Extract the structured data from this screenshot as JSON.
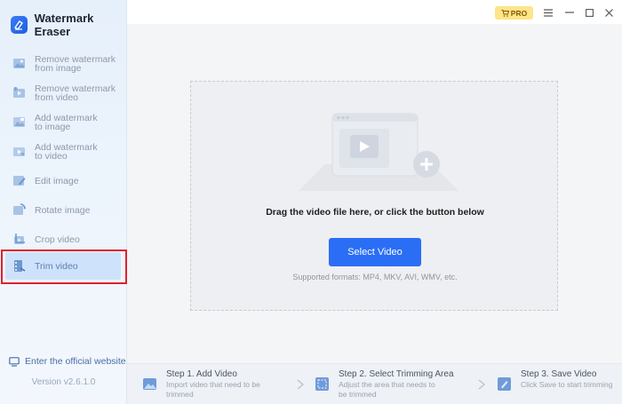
{
  "app": {
    "title": "Watermark Eraser",
    "pro_badge": "PRO"
  },
  "sidebar": {
    "items": [
      {
        "line1": "Remove watermark",
        "line2": "from image",
        "icon": "image-remove-icon",
        "active": false
      },
      {
        "line1": "Remove watermark",
        "line2": "from video",
        "icon": "video-remove-icon",
        "active": false
      },
      {
        "line1": "Add watermark",
        "line2": "to image",
        "icon": "image-add-icon",
        "active": false
      },
      {
        "line1": "Add watermark",
        "line2": "to video",
        "icon": "video-add-icon",
        "active": false
      },
      {
        "line1": "Edit image",
        "line2": "",
        "icon": "edit-image-icon",
        "active": false
      },
      {
        "line1": "Rotate image",
        "line2": "",
        "icon": "rotate-image-icon",
        "active": false
      },
      {
        "line1": "Crop video",
        "line2": "",
        "icon": "crop-video-icon",
        "active": false
      },
      {
        "line1": "Trim video",
        "line2": "",
        "icon": "trim-video-icon",
        "active": true
      }
    ],
    "website_label": "Enter the official website",
    "version": "Version v2.6.1.0"
  },
  "dropzone": {
    "instruction": "Drag the video file here, or click the button below",
    "button_label": "Select Video",
    "formats": "Supported formats: MP4, MKV, AVI, WMV, etc."
  },
  "steps": [
    {
      "title": "Step 1. Add Video",
      "desc": "Import video that need to be trimmed"
    },
    {
      "title": "Step 2. Select Trimming Area",
      "desc": "Adjust the area that needs to be trimmed"
    },
    {
      "title": "Step 3. Save Video",
      "desc": "Click Save to start trimming"
    }
  ],
  "colors": {
    "accent": "#2a6ef5",
    "highlight_frame": "#e0202c",
    "pro": "#fde58a"
  }
}
